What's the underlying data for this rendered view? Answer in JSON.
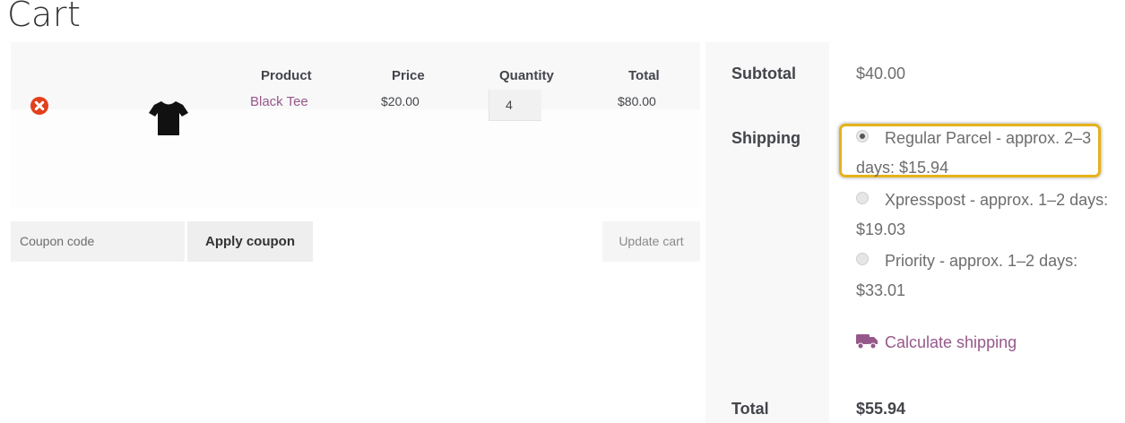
{
  "page": {
    "title": "Cart"
  },
  "cart": {
    "headers": {
      "product": "Product",
      "price": "Price",
      "quantity": "Quantity",
      "total": "Total"
    },
    "items": [
      {
        "name": "Black Tee",
        "price": "$20.00",
        "quantity": "4",
        "total": "$80.00",
        "image_icon": "black-tshirt-icon"
      }
    ],
    "coupon_placeholder": "Coupon code",
    "apply_coupon_label": "Apply coupon",
    "update_cart_label": "Update cart"
  },
  "totals": {
    "subtotal_label": "Subtotal",
    "subtotal_value": "$40.00",
    "shipping_label": "Shipping",
    "shipping_options": [
      {
        "label": "Regular Parcel - approx. 2–3 days: $15.94",
        "selected": true
      },
      {
        "label": "Xpresspost - approx. 1–2 days: $19.03",
        "selected": false
      },
      {
        "label": "Priority - approx. 1–2 days: $33.01",
        "selected": false
      }
    ],
    "calculate_shipping_label": "Calculate shipping",
    "total_label": "Total",
    "total_value": "$55.94"
  },
  "colors": {
    "link": "#96588a",
    "remove": "#e2401c",
    "highlight": "#e6b21a"
  }
}
